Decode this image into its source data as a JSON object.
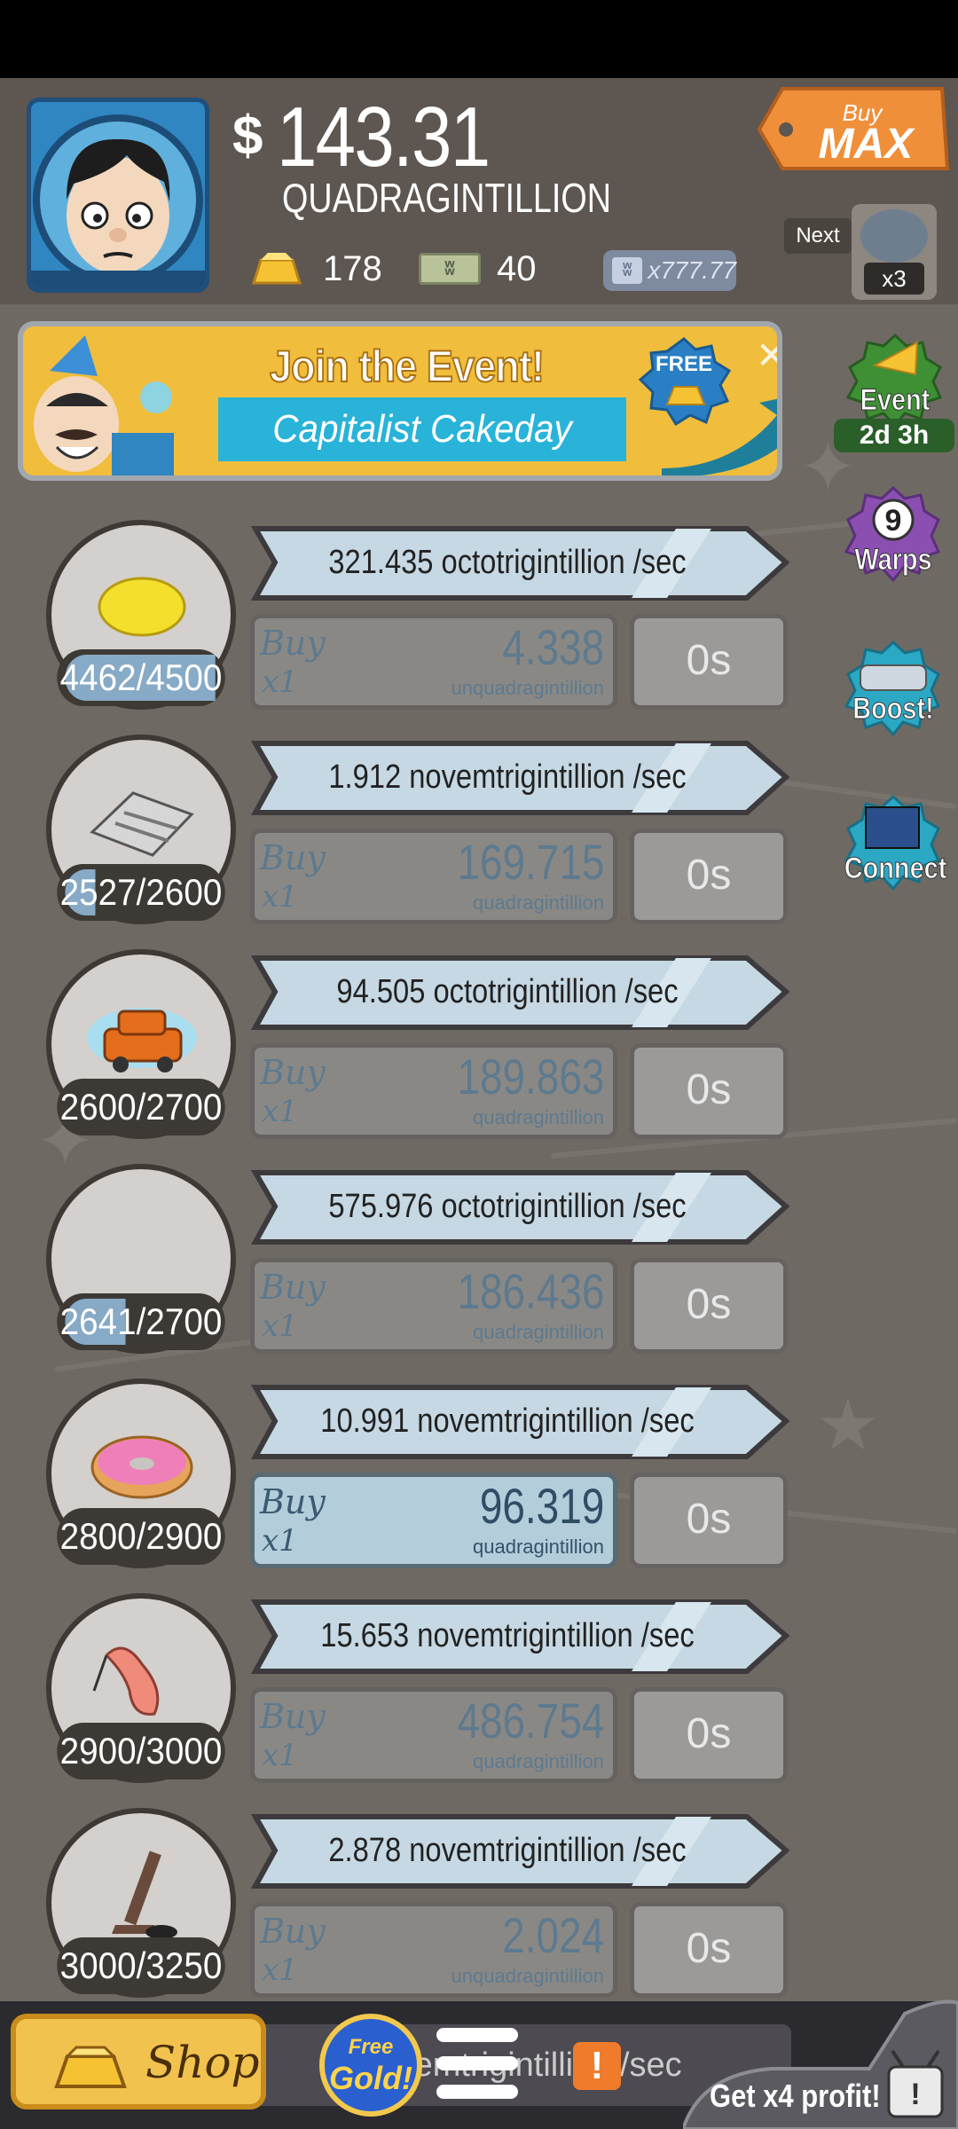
{
  "header": {
    "currency_symbol": "$",
    "money_amount": "143.31",
    "money_unit": "QUADRAGINTILLION",
    "gold": "178",
    "megabucks": "40",
    "multiplier": "x777.77",
    "bill_symbol": "ʬ",
    "buy_max": {
      "word1": "Buy",
      "word2": "MAX"
    },
    "next": {
      "label": "Next",
      "count": "x3"
    }
  },
  "event_banner": {
    "title": "Join the Event!",
    "subtitle": "Capitalist Cakeday",
    "badge": "FREE",
    "close": "✕"
  },
  "side_buttons": {
    "event": {
      "label": "Event",
      "timer": "2d 3h"
    },
    "warps": {
      "label": "Warps",
      "count": "9"
    },
    "boost": {
      "label": "Boost!"
    },
    "connect": {
      "label": "Connect"
    }
  },
  "businesses": [
    {
      "icon": "lemon-icon",
      "owned": "4462/4500",
      "progress": 0.99,
      "rate": "321.435 octotrigintillion /sec",
      "buy_word": "Buy",
      "buy_qty": "x1",
      "price": "4.338",
      "price_unit": "unquadragintillion",
      "timer": "0s"
    },
    {
      "icon": "newspaper-icon",
      "owned": "2527/2600",
      "progress": 0.2,
      "rate": "1.912 novemtrigintillion /sec",
      "buy_word": "Buy",
      "buy_qty": "x1",
      "price": "169.715",
      "price_unit": "quadragintillion",
      "timer": "0s"
    },
    {
      "icon": "car-icon",
      "owned": "2600/2700",
      "progress": 0,
      "rate": "94.505 octotrigintillion /sec",
      "buy_word": "Buy",
      "buy_qty": "x1",
      "price": "189.863",
      "price_unit": "quadragintillion",
      "timer": "0s"
    },
    {
      "icon": "pizza-icon",
      "owned": "2641/2700",
      "progress": 0.4,
      "rate": "575.976 octotrigintillion /sec",
      "buy_word": "Buy",
      "buy_qty": "x1",
      "price": "186.436",
      "price_unit": "quadragintillion",
      "timer": "0s"
    },
    {
      "icon": "donut-icon",
      "owned": "2800/2900",
      "progress": 0,
      "rate": "10.991 novemtrigintillion /sec",
      "buy_word": "Buy",
      "buy_qty": "x1",
      "price": "96.319",
      "price_unit": "quadragintillion",
      "timer": "0s",
      "active": true
    },
    {
      "icon": "shrimp-icon",
      "owned": "2900/3000",
      "progress": 0,
      "rate": "15.653 novemtrigintillion /sec",
      "buy_word": "Buy",
      "buy_qty": "x1",
      "price": "486.754",
      "price_unit": "quadragintillion",
      "timer": "0s"
    },
    {
      "icon": "hockey-icon",
      "owned": "3000/3250",
      "progress": 0,
      "rate": "2.878 novemtrigintillion /sec",
      "buy_word": "Buy",
      "buy_qty": "x1",
      "price": "2.024",
      "price_unit": "unquadragintillion",
      "timer": "0s"
    }
  ],
  "bottom_bar": {
    "shop": "Shop",
    "free_gold_line1": "Free",
    "free_gold_line2": "Gold!",
    "partial_rate": "novemtrigintillion /sec",
    "alert": "!",
    "x4_profit": "Get x4 profit!"
  },
  "colors": {
    "background": "#6f6963",
    "header": "#5e5650",
    "rate_bar": "#c6d8e3",
    "buy_active": "#b3cddb",
    "event_green": "#3f8f35",
    "warps_purple": "#8a4fb0",
    "boost_teal": "#2aa8c4",
    "buy_max_orange": "#f08f3a"
  }
}
